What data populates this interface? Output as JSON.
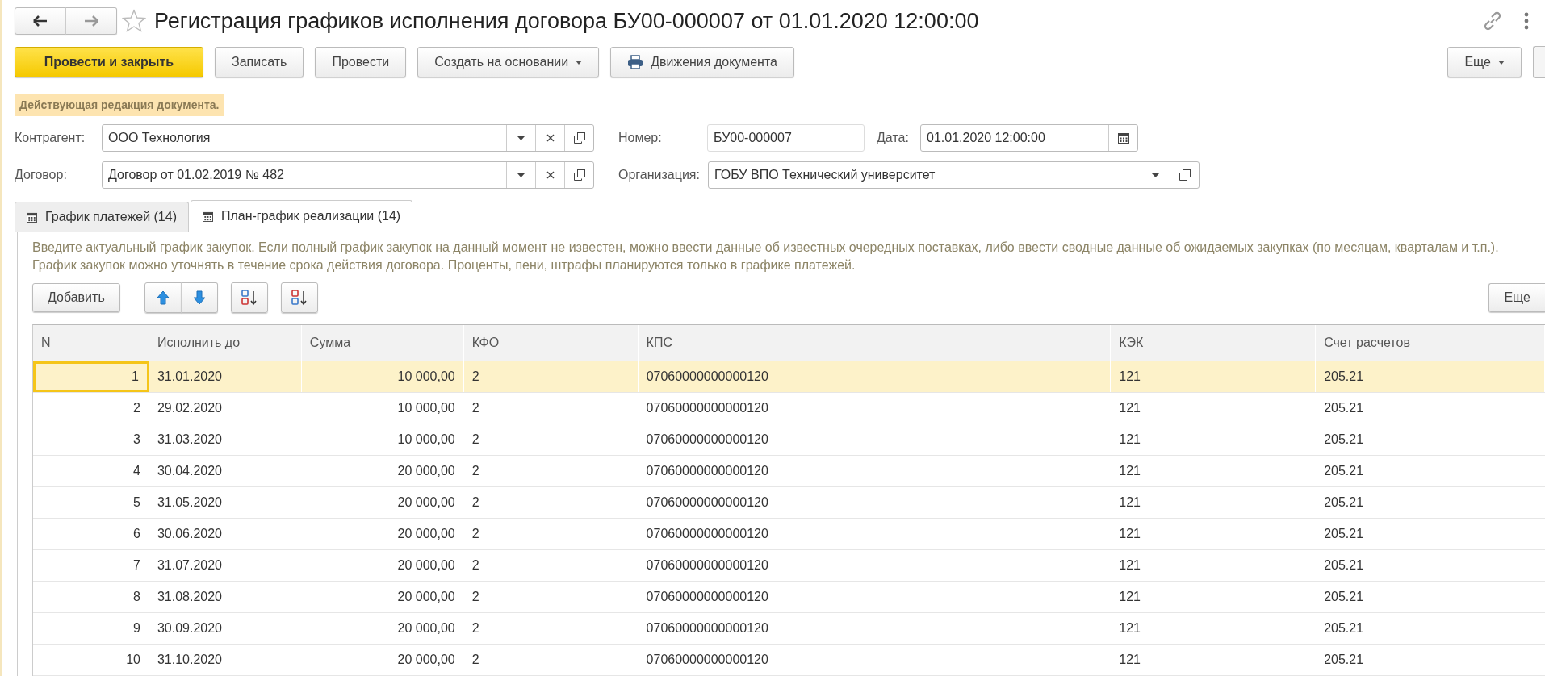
{
  "window": {
    "title": "Регистрация графиков исполнения договора БУ00-000007 от 01.01.2020 12:00:00"
  },
  "toolbar": {
    "buttons": [
      {
        "label": "Провести и закрыть",
        "kind": "primary"
      },
      {
        "label": "Записать",
        "kind": "plain"
      },
      {
        "label": "Провести",
        "kind": "plain"
      },
      {
        "label": "Создать на основании",
        "kind": "menu"
      },
      {
        "label": "Движения документа",
        "kind": "print"
      }
    ],
    "more": "Еще"
  },
  "notice": "Действующая редакция документа.",
  "fields": {
    "counterparty": {
      "label": "Контрагент:",
      "value": "ООО Технология"
    },
    "number": {
      "label": "Номер:",
      "value": "БУ00-000007"
    },
    "date": {
      "label": "Дата:",
      "value": "01.01.2020 12:00:00"
    },
    "contract": {
      "label": "Договор:",
      "value": "Договор от 01.02.2019 № 482"
    },
    "organization": {
      "label": "Организация:",
      "value": "ГОБУ ВПО Технический университет"
    }
  },
  "tabs": [
    {
      "label": "График платежей (14)",
      "selected": false
    },
    {
      "label": "План-график реализации (14)",
      "selected": true
    }
  ],
  "hint": "Введите актуальный график закупок. Если полный график закупок на данный момент не известен, можно ввести данные об известных очередных поставках, либо ввести сводные данные об ожидаемых закупках (по месяцам, кварталам и т.п.). График закупок можно уточнять в течение срока действия договора. Проценты, пени, штрафы планируются только в графике платежей.",
  "table_toolbar": {
    "add": "Добавить",
    "more": "Еще"
  },
  "table": {
    "columns": [
      "N",
      "Исполнить до",
      "Сумма",
      "КФО",
      "КПС",
      "КЭК",
      "Счет расчетов"
    ],
    "rows": [
      {
        "cells": [
          "1",
          "31.01.2020",
          "10 000,00",
          "2",
          "07060000000000120",
          "121",
          "205.21"
        ],
        "selected": true
      },
      {
        "cells": [
          "2",
          "29.02.2020",
          "10 000,00",
          "2",
          "07060000000000120",
          "121",
          "205.21"
        ],
        "selected": false
      },
      {
        "cells": [
          "3",
          "31.03.2020",
          "10 000,00",
          "2",
          "07060000000000120",
          "121",
          "205.21"
        ],
        "selected": false
      },
      {
        "cells": [
          "4",
          "30.04.2020",
          "20 000,00",
          "2",
          "07060000000000120",
          "121",
          "205.21"
        ],
        "selected": false
      },
      {
        "cells": [
          "5",
          "31.05.2020",
          "20 000,00",
          "2",
          "07060000000000120",
          "121",
          "205.21"
        ],
        "selected": false
      },
      {
        "cells": [
          "6",
          "30.06.2020",
          "20 000,00",
          "2",
          "07060000000000120",
          "121",
          "205.21"
        ],
        "selected": false
      },
      {
        "cells": [
          "7",
          "31.07.2020",
          "20 000,00",
          "2",
          "07060000000000120",
          "121",
          "205.21"
        ],
        "selected": false
      },
      {
        "cells": [
          "8",
          "31.08.2020",
          "20 000,00",
          "2",
          "07060000000000120",
          "121",
          "205.21"
        ],
        "selected": false
      },
      {
        "cells": [
          "9",
          "30.09.2020",
          "20 000,00",
          "2",
          "07060000000000120",
          "121",
          "205.21"
        ],
        "selected": false
      },
      {
        "cells": [
          "10",
          "31.10.2020",
          "20 000,00",
          "2",
          "07060000000000120",
          "121",
          "205.21"
        ],
        "selected": false
      }
    ]
  }
}
